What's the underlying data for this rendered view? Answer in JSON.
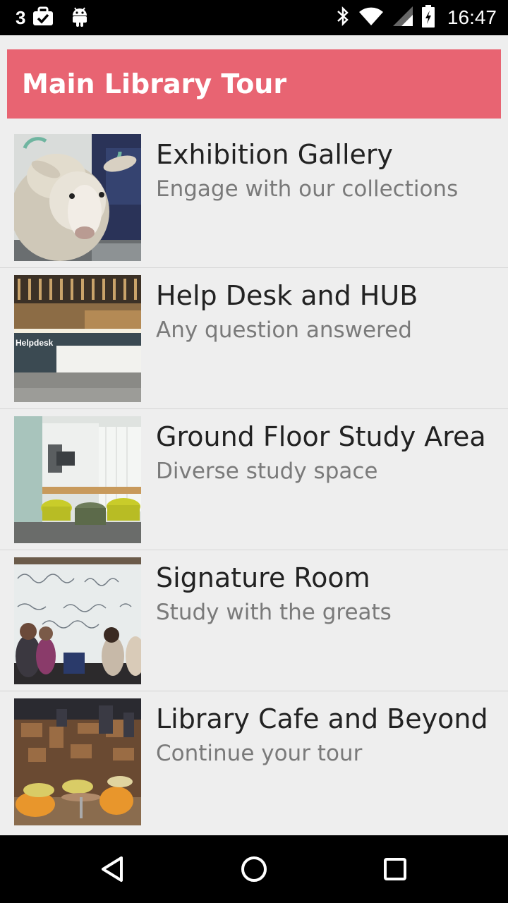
{
  "status_bar": {
    "notification_count": "3",
    "time": "16:47",
    "icons": [
      "briefcase-check-icon",
      "android-icon",
      "bluetooth-icon",
      "wifi-icon",
      "signal-icon",
      "battery-charging-icon"
    ]
  },
  "app_bar": {
    "title": "Main Library Tour",
    "color": "#e86472"
  },
  "tour_items": [
    {
      "title": "Exhibition Gallery",
      "subtitle": "Engage with our collections"
    },
    {
      "title": "Help Desk and HUB",
      "subtitle": "Any question answered"
    },
    {
      "title": "Ground Floor Study Area",
      "subtitle": "Diverse study space"
    },
    {
      "title": "Signature Room",
      "subtitle": "Study with the greats"
    },
    {
      "title": "Library Cafe and Beyond",
      "subtitle": "Continue your tour"
    }
  ],
  "thumb_text": {
    "helpdesk_sign": "Helpdesk"
  },
  "nav_bar": {
    "icons": [
      "back-icon",
      "home-icon",
      "recents-icon"
    ]
  }
}
